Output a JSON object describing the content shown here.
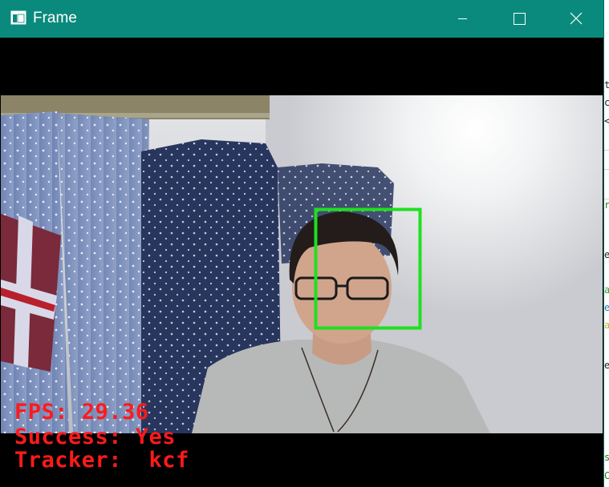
{
  "window": {
    "title": "Frame",
    "icon": "window-app-icon",
    "controls": {
      "minimize": "minimize-icon",
      "maximize": "maximize-icon",
      "close": "close-icon"
    }
  },
  "overlay": {
    "fps": "FPS: 29.36",
    "success": "Success: Yes",
    "tracker": "Tracker:  kcf",
    "color": "#ff1a1a"
  },
  "tracking_box": {
    "color": "#1fe01f"
  },
  "colors": {
    "titlebar": "#0a8a7d",
    "client_background": "#000000"
  },
  "background_app": {
    "glyphs": [
      "t",
      "c",
      "<",
      "r",
      "e",
      "a",
      "e",
      "a",
      "e",
      "s",
      "C"
    ]
  }
}
